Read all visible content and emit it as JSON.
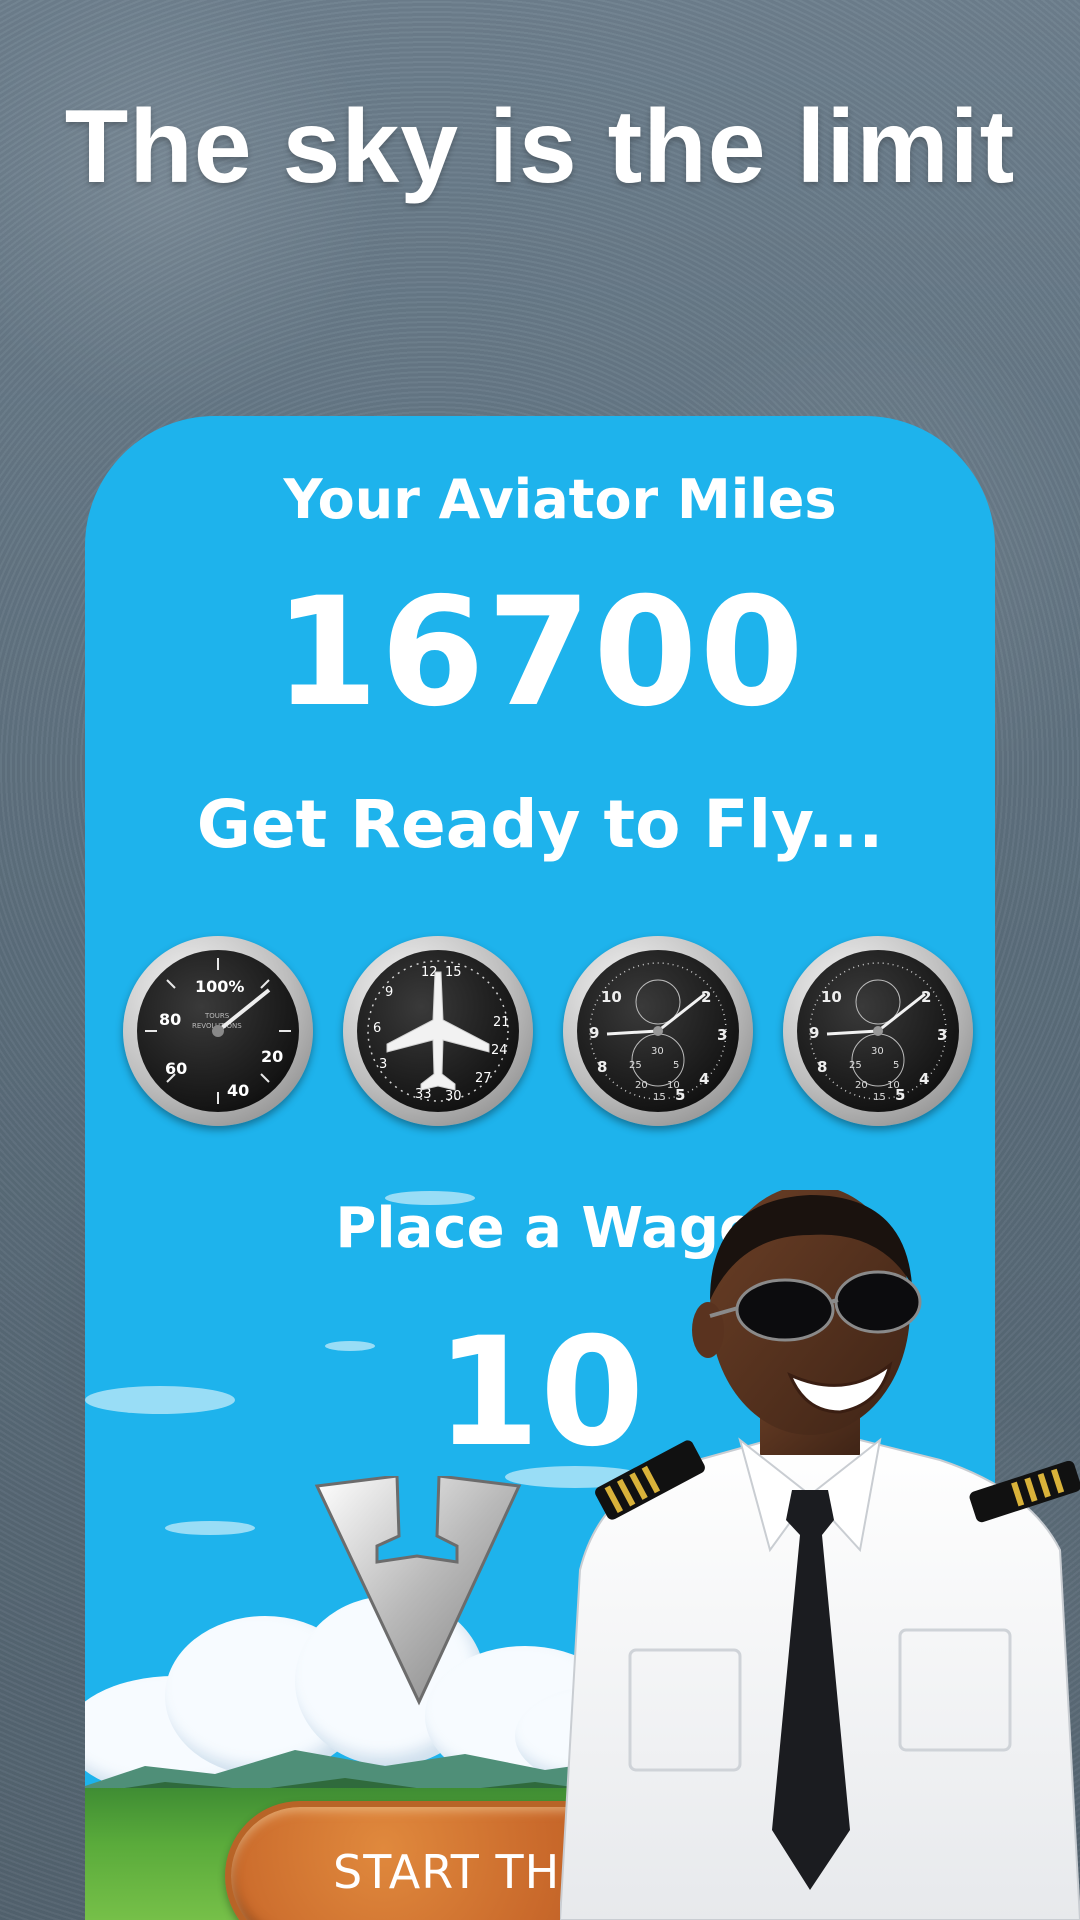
{
  "promo": {
    "headline": "The sky is the limit"
  },
  "game": {
    "miles_label": "Your Aviator Miles",
    "miles_value": "16700",
    "ready_label": "Get Ready to Fly...",
    "wager_label": "Place a Wager",
    "wager_value": "10",
    "start_button_label": "START THE GAME"
  },
  "gauges": [
    {
      "name": "tachometer-gauge",
      "labels": [
        "100%",
        "80",
        "60",
        "40",
        "20",
        "TOURS",
        "REVOLUTIONS"
      ]
    },
    {
      "name": "heading-indicator-gauge",
      "labels": [
        "12",
        "15",
        "21",
        "24",
        "27",
        "30",
        "33",
        "3",
        "6",
        "9"
      ]
    },
    {
      "name": "chronograph-gauge",
      "labels": [
        "10",
        "2",
        "3",
        "4",
        "5",
        "8",
        "9",
        "25",
        "20",
        "15",
        "30"
      ]
    },
    {
      "name": "chronograph-gauge",
      "labels": [
        "10",
        "2",
        "3",
        "4",
        "5",
        "8",
        "9",
        "25",
        "20",
        "15",
        "30"
      ]
    }
  ],
  "colors": {
    "screen_bg": "#1eb3ec",
    "text": "#ffffff",
    "button": "#c9692b",
    "backdrop": "#5f7180"
  },
  "icons": {
    "decrease": "chevron-down-icon",
    "increase": "chevron-up-icon",
    "plane": "airplane-icon"
  }
}
